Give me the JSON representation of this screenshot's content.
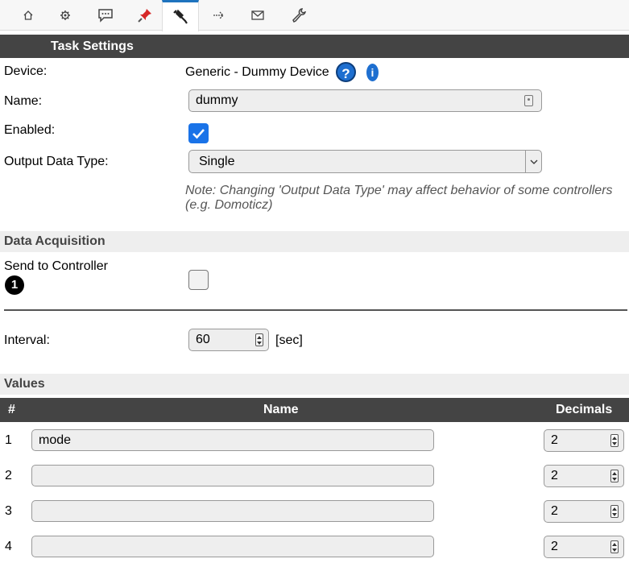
{
  "nav": {
    "tabs": [
      {
        "icon": "home-icon"
      },
      {
        "icon": "gear-icon"
      },
      {
        "icon": "chat-icon"
      },
      {
        "icon": "pin-icon"
      },
      {
        "icon": "plug-icon",
        "active": true
      },
      {
        "icon": "arrow-right-icon"
      },
      {
        "icon": "mail-icon"
      },
      {
        "icon": "wrench-icon"
      }
    ]
  },
  "task_settings": {
    "title": "Task Settings",
    "device_label": "Device:",
    "device_value": "Generic - Dummy Device",
    "help_glyph": "?",
    "info_glyph": "i",
    "name_label": "Name:",
    "name_value": "dummy",
    "enabled_label": "Enabled:",
    "enabled_checked": true,
    "output_type_label": "Output Data Type:",
    "output_type_value": "Single",
    "note": "Note: Changing 'Output Data Type' may affect behavior of some controllers (e.g. Domoticz)"
  },
  "data_acquisition": {
    "title": "Data Acquisition",
    "send_label": "Send to Controller",
    "controller_badge": "1",
    "send_checked": false,
    "interval_label": "Interval:",
    "interval_value": "60",
    "interval_unit": "[sec]"
  },
  "values": {
    "title": "Values",
    "headers": {
      "num": "#",
      "name": "Name",
      "decimals": "Decimals"
    },
    "rows": [
      {
        "num": "1",
        "name": "mode",
        "decimals": "2"
      },
      {
        "num": "2",
        "name": "",
        "decimals": "2"
      },
      {
        "num": "3",
        "name": "",
        "decimals": "2"
      },
      {
        "num": "4",
        "name": "",
        "decimals": "2"
      }
    ]
  },
  "colors": {
    "header_dark": "#444444",
    "section_light": "#eeeeee",
    "accent": "#1e73be",
    "checkbox_blue": "#1a73e8"
  }
}
